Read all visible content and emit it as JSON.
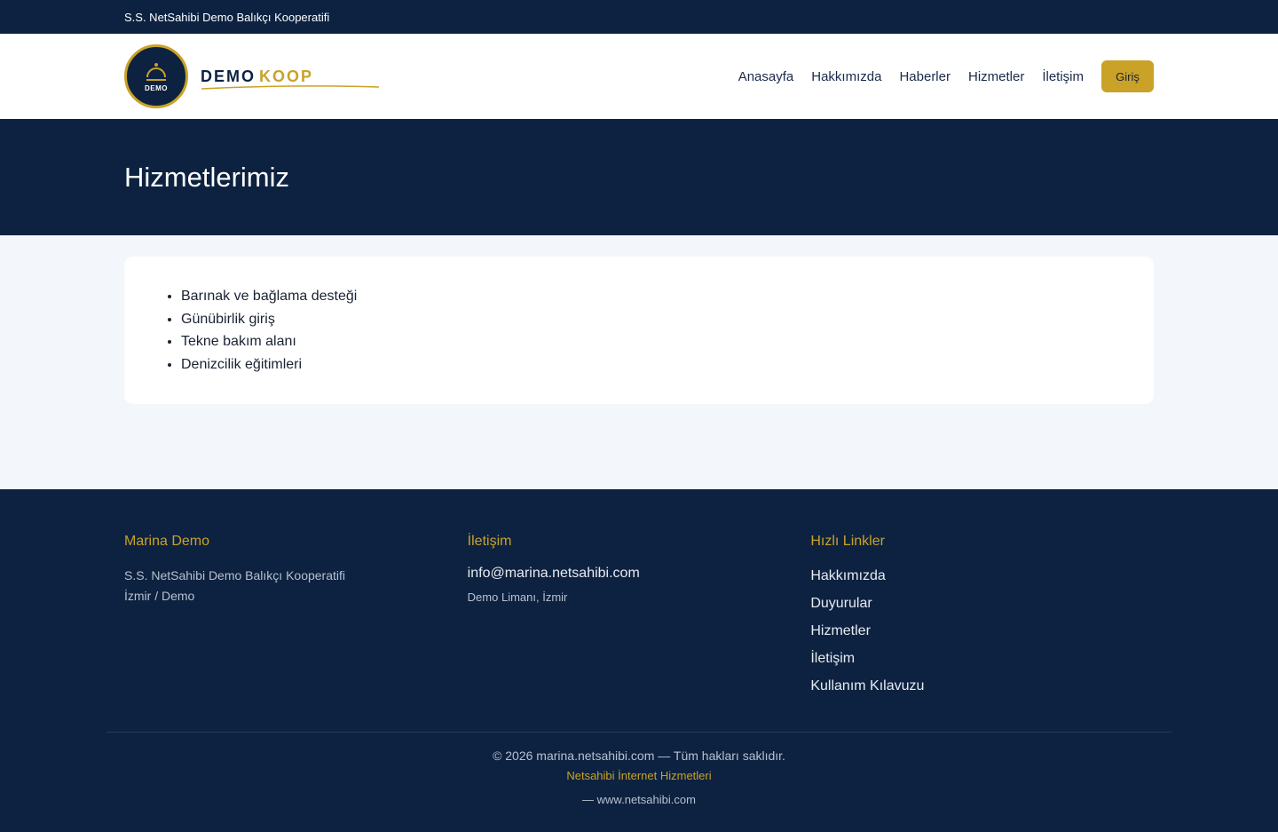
{
  "topbar": {
    "org_name": "S.S. NetSahibi Demo Balıkçı Kooperatifi"
  },
  "brand": {
    "logo_caption": "DEMO",
    "word1": "DEMO",
    "word2": "KOOP"
  },
  "nav": {
    "items": [
      {
        "label": "Anasayfa"
      },
      {
        "label": "Hakkımızda"
      },
      {
        "label": "Haberler"
      },
      {
        "label": "Hizmetler"
      },
      {
        "label": "İletişim"
      }
    ],
    "login_label": "Giriş"
  },
  "hero": {
    "title": "Hizmetlerimiz"
  },
  "services": {
    "items": [
      "Barınak ve bağlama desteği",
      "Günübirlik giriş",
      "Tekne bakım alanı",
      "Denizcilik eğitimleri"
    ]
  },
  "footer": {
    "about": {
      "heading": "Marina Demo",
      "line1": "S.S. NetSahibi Demo Balıkçı Kooperatifi",
      "line2": "İzmir / Demo"
    },
    "contact": {
      "heading": "İletişim",
      "email": "info@marina.netsahibi.com",
      "address": "Demo Limanı, İzmir"
    },
    "quick": {
      "heading": "Hızlı Linkler",
      "links": [
        "Hakkımızda",
        "Duyurular",
        "Hizmetler",
        "İletişim",
        "Kullanım Kılavuzu"
      ]
    },
    "copyright": "© 2026 marina.netsahibi.com — Tüm hakları saklıdır.",
    "provider": "Netsahibi İnternet Hizmetleri",
    "site": "— www.netsahibi.com"
  },
  "colors": {
    "navy": "#0d2240",
    "gold": "#c9a227",
    "page_bg": "#f3f6fa"
  }
}
